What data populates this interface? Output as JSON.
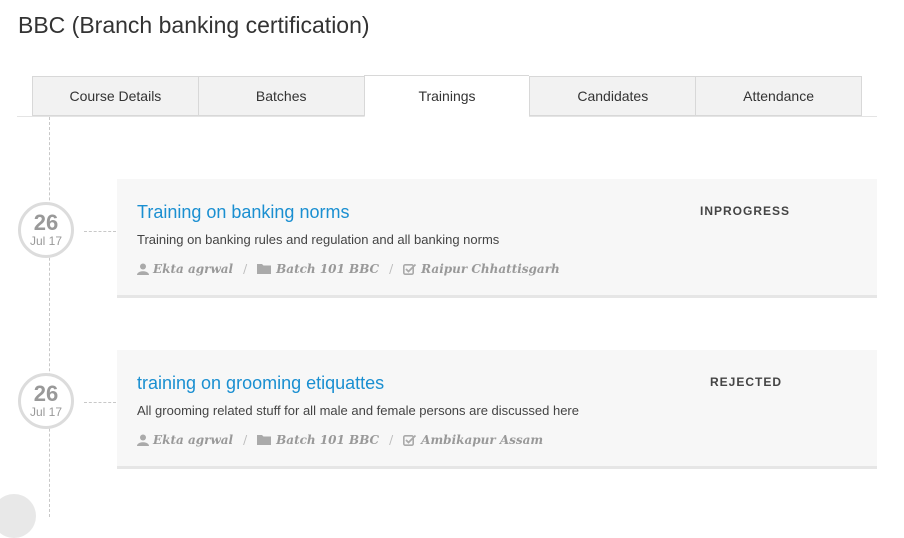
{
  "page": {
    "title": "BBC (Branch banking certification)"
  },
  "tabs": [
    {
      "label": "Course Details"
    },
    {
      "label": "Batches"
    },
    {
      "label": "Trainings"
    },
    {
      "label": "Candidates"
    },
    {
      "label": "Attendance"
    }
  ],
  "active_tab": "Trainings",
  "trainings": [
    {
      "day": "26",
      "month": "Jul 17",
      "title": "Training on banking norms",
      "description": "Training on banking rules and regulation and all banking norms",
      "status": "INPROGRESS",
      "trainer": "Ekta agrwal",
      "batch": "Batch 101 BBC",
      "location": "Raipur Chhattisgarh"
    },
    {
      "day": "26",
      "month": "Jul 17",
      "title": "training on grooming etiquattes",
      "description": "All grooming related stuff for all male and female persons are discussed here",
      "status": "REJECTED",
      "trainer": "Ekta agrwal",
      "batch": "Batch 101 BBC",
      "location": "Ambikapur Assam"
    }
  ],
  "icons": {
    "trainer": "user-icon",
    "batch": "folder-icon",
    "location": "check-square-icon"
  },
  "colors": {
    "link": "#1a8fd1",
    "card_bg": "#f7f7f7"
  }
}
